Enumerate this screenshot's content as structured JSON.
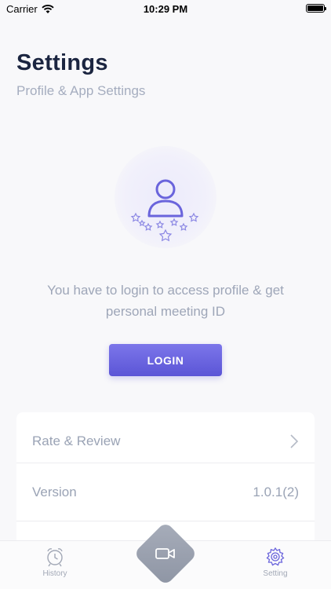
{
  "status_bar": {
    "carrier": "Carrier",
    "time": "10:29 PM"
  },
  "header": {
    "title": "Settings",
    "subtitle": "Profile & App Settings"
  },
  "login": {
    "message": "You have to login to access profile & get personal meeting ID",
    "button_label": "LOGIN"
  },
  "settings_list": {
    "rate_review_label": "Rate & Review",
    "version_label": "Version",
    "version_value": "1.0.1(2)"
  },
  "tab_bar": {
    "history_label": "History",
    "setting_label": "Setting"
  },
  "colors": {
    "accent": "#5b55d6",
    "title": "#1b2540",
    "muted_text": "#9ea6b8"
  },
  "icons": {
    "wifi": "wifi-icon",
    "battery": "battery-icon",
    "avatar": "user-icon",
    "chevron": "chevron-right-icon",
    "history": "alarm-clock-icon",
    "camera": "video-camera-icon",
    "setting": "gear-icon"
  }
}
